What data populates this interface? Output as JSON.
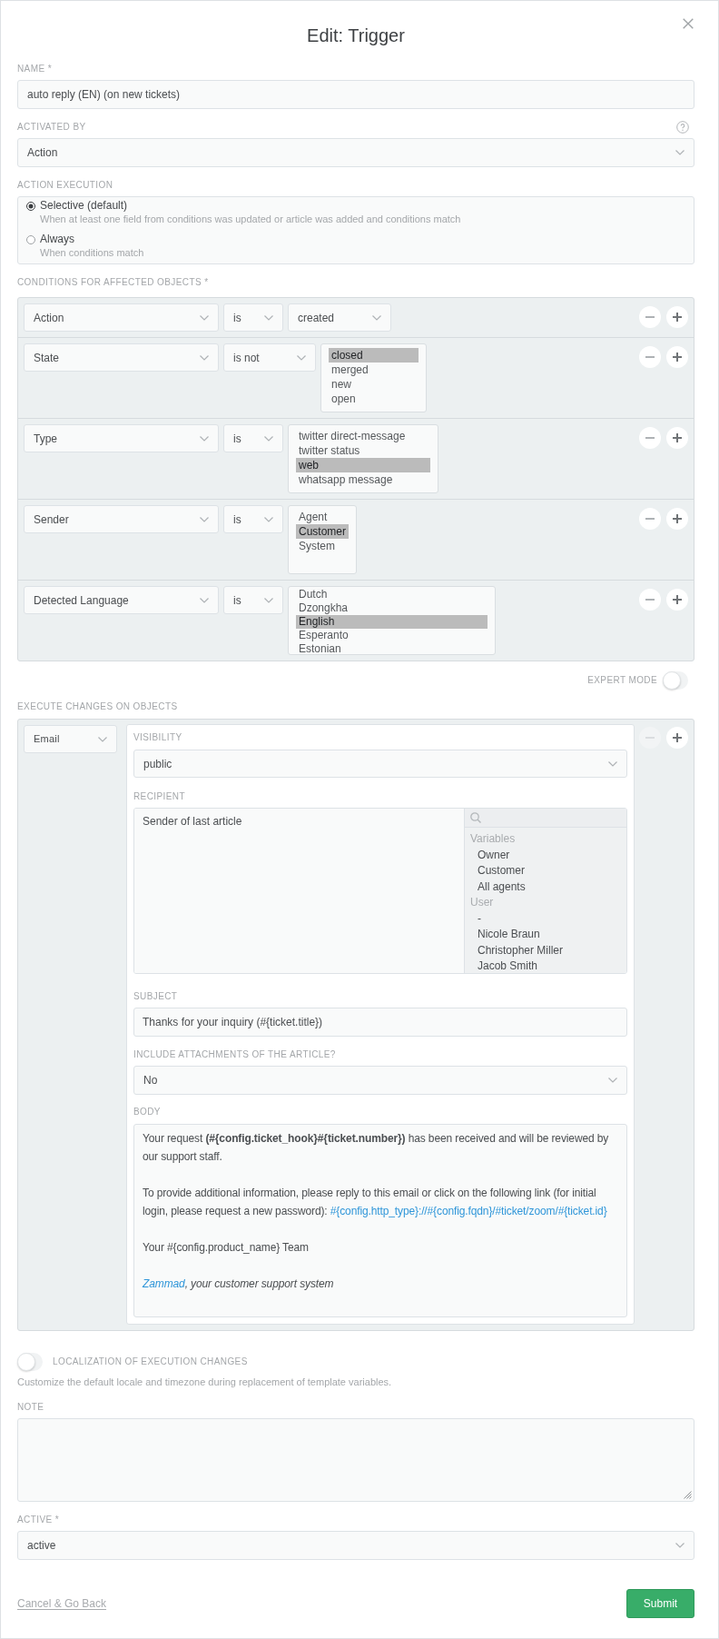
{
  "dialog": {
    "title": "Edit: Trigger"
  },
  "name": {
    "label": "NAME *",
    "value": "auto reply (EN) (on new tickets)"
  },
  "activated_by": {
    "label": "ACTIVATED BY",
    "value": "Action"
  },
  "action_execution": {
    "label": "ACTION EXECUTION",
    "options": [
      {
        "label": "Selective (default)",
        "description": "When at least one field from conditions was updated or article was added and conditions match",
        "selected": true
      },
      {
        "label": "Always",
        "description": "When conditions match",
        "selected": false
      }
    ]
  },
  "conditions": {
    "label": "CONDITIONS FOR AFFECTED OBJECTS *",
    "rows": [
      {
        "attribute": "Action",
        "operator": "is",
        "kind": "select",
        "value": "created",
        "remove_disabled": false
      },
      {
        "attribute": "State",
        "operator": "is not",
        "kind": "multiselect",
        "options": [
          {
            "label": "closed",
            "selected": true
          },
          {
            "label": "merged",
            "selected": false
          },
          {
            "label": "new",
            "selected": false
          },
          {
            "label": "open",
            "selected": false
          }
        ],
        "remove_disabled": false
      },
      {
        "attribute": "Type",
        "operator": "is",
        "kind": "multiselect",
        "options": [
          {
            "label": "twitter direct-message",
            "selected": false
          },
          {
            "label": "twitter status",
            "selected": false
          },
          {
            "label": "web",
            "selected": true
          },
          {
            "label": "whatsapp message",
            "selected": false
          }
        ],
        "remove_disabled": false
      },
      {
        "attribute": "Sender",
        "operator": "is",
        "kind": "multiselect",
        "options": [
          {
            "label": "Agent",
            "selected": false
          },
          {
            "label": "Customer",
            "selected": true
          },
          {
            "label": "System",
            "selected": false
          }
        ],
        "remove_disabled": false
      },
      {
        "attribute": "Detected Language",
        "operator": "is",
        "kind": "multiselect",
        "options": [
          {
            "label": "Dutch",
            "selected": false
          },
          {
            "label": "Dzongkha",
            "selected": false
          },
          {
            "label": "English",
            "selected": true
          },
          {
            "label": "Esperanto",
            "selected": false
          },
          {
            "label": "Estonian",
            "selected": false
          }
        ],
        "remove_disabled": false
      }
    ]
  },
  "expert_mode": {
    "label": "EXPERT MODE",
    "on": false
  },
  "execute": {
    "label": "EXECUTE CHANGES ON OBJECTS",
    "rows": [
      {
        "action": "Email",
        "remove_disabled": true,
        "fields": [
          {
            "kind": "select",
            "label": "VISIBILITY",
            "value": "public"
          },
          {
            "kind": "recipient",
            "label": "RECIPIENT",
            "value": "Sender of last article",
            "groups": [
              {
                "title": "Variables",
                "items": [
                  "Owner",
                  "Customer",
                  "All agents"
                ]
              },
              {
                "title": "User",
                "items": [
                  "-",
                  "Nicole Braun",
                  "Christopher Miller",
                  "Jacob Smith"
                ]
              }
            ]
          },
          {
            "kind": "text",
            "label": "SUBJECT",
            "value": "Thanks for your inquiry (#{ticket.title})"
          },
          {
            "kind": "select",
            "label": "INCLUDE ATTACHMENTS OF THE ARTICLE?",
            "value": "No"
          },
          {
            "kind": "richtext",
            "label": "BODY",
            "paragraphs": [
              {
                "kind": "plain",
                "text": "Your request **(#{config.ticket_hook}#{ticket.number})** has been received and will be reviewed by our support staff."
              },
              {
                "kind": "link_end",
                "text": "To provide additional information, please reply to this email or click on the following link (for initial login, please request a new password):",
                "link": "#{config.http_type}://#{config.fqdn}/#ticket/zoom/#{ticket.id}"
              },
              {
                "kind": "plain",
                "text": "Your #{config.product_name} Team"
              },
              {
                "kind": "signature",
                "link": "Zammad",
                "text": ", your customer support system"
              }
            ]
          }
        ]
      }
    ]
  },
  "localization": {
    "label": "LOCALIZATION OF EXECUTION CHANGES",
    "on": false,
    "description": "Customize the default locale and timezone during replacement of template variables."
  },
  "note": {
    "label": "NOTE"
  },
  "active": {
    "label": "ACTIVE *",
    "value": "active"
  },
  "footer": {
    "cancel": "Cancel & Go Back",
    "submit": "Submit"
  }
}
